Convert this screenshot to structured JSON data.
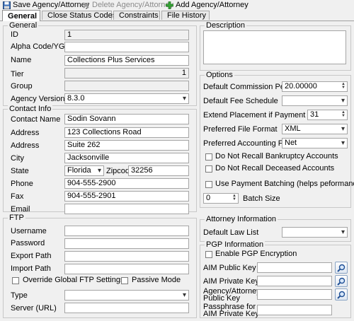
{
  "toolbar": {
    "save_label": "Save Agency/Attorney",
    "delete_label": "Delete Agency/Attorney",
    "add_label": "Add Agency/Attorney"
  },
  "tabs": [
    {
      "label": "General",
      "icon": "gear-icon"
    },
    {
      "label": "Close Status Codes",
      "icon": "globe-icon"
    },
    {
      "label": "Constraints",
      "icon": "stop-icon"
    },
    {
      "label": "File History",
      "icon": "history-icon"
    }
  ],
  "general": {
    "legend": "General",
    "id_label": "ID",
    "id_value": "1",
    "alpha_label": "Alpha Code/YGC ID",
    "alpha_value": "",
    "name_label": "Name",
    "name_value": "Collections Plus Services",
    "tier_label": "Tier",
    "tier_value": "1",
    "group_label": "Group",
    "group_value": "",
    "version_label": "Agency Version",
    "version_value": "8.3.0"
  },
  "contact": {
    "legend": "Contact Info",
    "contact_name_label": "Contact Name",
    "contact_name_value": "Sodin Sovann",
    "address1_label": "Address",
    "address1_value": "123 Collections Road",
    "address2_label": "Address",
    "address2_value": "Suite 262",
    "city_label": "City",
    "city_value": "Jacksonville",
    "state_label": "State",
    "state_value": "Florida",
    "zip_label": "Zipcode",
    "zip_value": "32256",
    "phone_label": "Phone",
    "phone_value": "904-555-2900",
    "fax_label": "Fax",
    "fax_value": "904-555-2901",
    "email_label": "Email",
    "email_value": ""
  },
  "ftp": {
    "legend": "FTP",
    "username_label": "Username",
    "username_value": "",
    "password_label": "Password",
    "password_value": "",
    "export_label": "Export Path",
    "export_value": "",
    "import_label": "Import Path",
    "import_value": "",
    "override_label": "Override Global FTP Settings",
    "override_checked": false,
    "passive_label": "Passive Mode",
    "passive_checked": false,
    "type_label": "Type",
    "type_value": "",
    "server_label": "Server (URL)",
    "server_value": ""
  },
  "description": {
    "legend": "Description",
    "value": ""
  },
  "options": {
    "legend": "Options",
    "commission_label": "Default Commission Percentage",
    "commission_value": "20.00000",
    "fee_label": "Default Fee Schedule",
    "fee_value": "",
    "extend_label": "Extend Placement if Payment is Received",
    "extend_value": "31",
    "file_format_label": "Preferred File Format",
    "file_format_value": "XML",
    "acct_format_label": "Preferred Accounting Format",
    "acct_format_value": "Net",
    "no_bankruptcy_label": "Do Not Recall Bankruptcy Accounts",
    "no_bankruptcy_checked": false,
    "no_deceased_label": "Do Not Recall Deceased Accounts",
    "no_deceased_checked": false,
    "batching_label": "Use Payment Batching (helps peformance)",
    "batching_checked": false,
    "batch_size_value": "0",
    "batch_size_label": "Batch Size"
  },
  "attorney": {
    "legend": "Attorney Information",
    "law_list_label": "Default Law List",
    "law_list_value": ""
  },
  "pgp": {
    "legend": "PGP Information",
    "enable_label": "Enable PGP Encryption",
    "enable_checked": false,
    "aim_public_label": "AIM Public Key",
    "aim_public_value": "",
    "aim_private_label": "AIM Private Key",
    "aim_private_value": "",
    "agency_public_label_1": "Agency/Attorney",
    "agency_public_label_2": "Public Key",
    "agency_public_value": "",
    "passphrase_label_1": "Passphrase for",
    "passphrase_label_2": "AIM Private Key",
    "passphrase_value": ""
  },
  "colors": {
    "accent": "#316ac5",
    "disabled_text": "#8a8a8a",
    "panel_bg": "#f0f0f0"
  }
}
